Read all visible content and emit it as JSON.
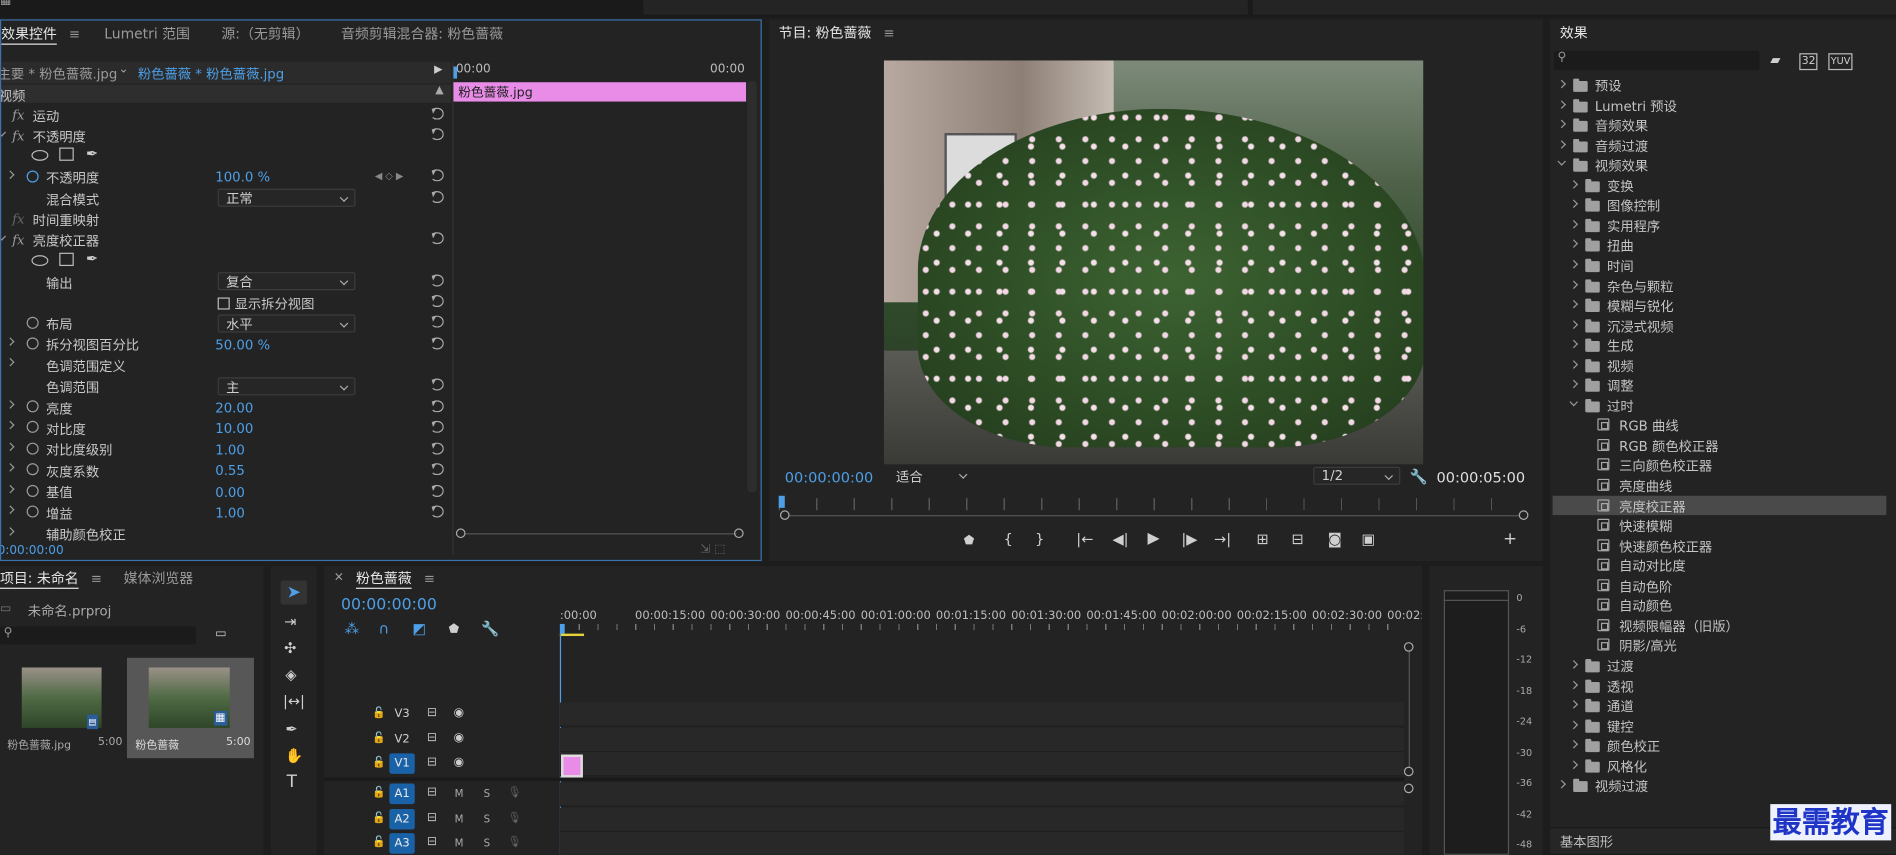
{
  "effect_controls": {
    "tabs": [
      "效果控件",
      "Lumetri 范围",
      "源:（无剪辑）",
      "音频剪辑混合器: 粉色蔷薇"
    ],
    "master_label": "主要 * 粉色蔷薇.jpg",
    "clip_label": "粉色蔷薇 * 粉色蔷薇.jpg",
    "mini_timeline": {
      "start": "00:00",
      "end": "00:00",
      "clip_name": "粉色蔷薇.jpg"
    },
    "section_video": "视频",
    "rows": {
      "motion": "运动",
      "opacity": "不透明度",
      "opacity_param": "不透明度",
      "opacity_value": "100.0 %",
      "blend_mode": "混合模式",
      "blend_value": "正常",
      "time_remap": "时间重映射",
      "luma_corrector": "亮度校正器",
      "output": "输出",
      "output_value": "复合",
      "split_view": "显示拆分视图",
      "layout": "布局",
      "layout_value": "水平",
      "split_pct": "拆分视图百分比",
      "split_pct_value": "50.00 %",
      "tonal_range_def": "色调范围定义",
      "tonal_range": "色调范围",
      "tonal_range_value": "主",
      "brightness": "亮度",
      "brightness_value": "20.00",
      "contrast": "对比度",
      "contrast_value": "10.00",
      "contrast_level": "对比度级别",
      "contrast_level_value": "1.00",
      "gamma": "灰度系数",
      "gamma_value": "0.55",
      "pedestal": "基值",
      "pedestal_value": "0.00",
      "gain": "增益",
      "gain_value": "1.00",
      "secondary": "辅助颜色校正"
    },
    "timecode": "0:00:00:00"
  },
  "program": {
    "title": "节目: 粉色蔷薇",
    "timecode_left": "00:00:00:00",
    "zoom": "适合",
    "resolution": "1/2",
    "timecode_right": "00:00:05:00"
  },
  "effects": {
    "title": "效果",
    "tree": [
      {
        "label": "预设",
        "level": 0,
        "icon": "preset"
      },
      {
        "label": "Lumetri 预设",
        "level": 0,
        "icon": "preset"
      },
      {
        "label": "音频效果",
        "level": 0,
        "icon": "folder"
      },
      {
        "label": "音频过渡",
        "level": 0,
        "icon": "folder"
      },
      {
        "label": "视频效果",
        "level": 0,
        "icon": "folder",
        "open": true
      },
      {
        "label": "变换",
        "level": 1,
        "icon": "folder"
      },
      {
        "label": "图像控制",
        "level": 1,
        "icon": "folder"
      },
      {
        "label": "实用程序",
        "level": 1,
        "icon": "folder"
      },
      {
        "label": "扭曲",
        "level": 1,
        "icon": "folder"
      },
      {
        "label": "时间",
        "level": 1,
        "icon": "folder"
      },
      {
        "label": "杂色与颗粒",
        "level": 1,
        "icon": "folder"
      },
      {
        "label": "模糊与锐化",
        "level": 1,
        "icon": "folder"
      },
      {
        "label": "沉浸式视频",
        "level": 1,
        "icon": "folder"
      },
      {
        "label": "生成",
        "level": 1,
        "icon": "folder"
      },
      {
        "label": "视频",
        "level": 1,
        "icon": "folder"
      },
      {
        "label": "调整",
        "level": 1,
        "icon": "folder"
      },
      {
        "label": "过时",
        "level": 1,
        "icon": "folder",
        "open": true
      },
      {
        "label": "RGB 曲线",
        "level": 2,
        "icon": "effect"
      },
      {
        "label": "RGB 颜色校正器",
        "level": 2,
        "icon": "effect"
      },
      {
        "label": "三向颜色校正器",
        "level": 2,
        "icon": "effect"
      },
      {
        "label": "亮度曲线",
        "level": 2,
        "icon": "effect"
      },
      {
        "label": "亮度校正器",
        "level": 2,
        "icon": "effect",
        "selected": true
      },
      {
        "label": "快速模糊",
        "level": 2,
        "icon": "effect"
      },
      {
        "label": "快速颜色校正器",
        "level": 2,
        "icon": "effect"
      },
      {
        "label": "自动对比度",
        "level": 2,
        "icon": "effect"
      },
      {
        "label": "自动色阶",
        "level": 2,
        "icon": "effect"
      },
      {
        "label": "自动颜色",
        "level": 2,
        "icon": "effect"
      },
      {
        "label": "视频限幅器（旧版）",
        "level": 2,
        "icon": "effect"
      },
      {
        "label": "阴影/高光",
        "level": 2,
        "icon": "effect"
      },
      {
        "label": "过渡",
        "level": 1,
        "icon": "folder"
      },
      {
        "label": "透视",
        "level": 1,
        "icon": "folder"
      },
      {
        "label": "通道",
        "level": 1,
        "icon": "folder"
      },
      {
        "label": "键控",
        "level": 1,
        "icon": "folder"
      },
      {
        "label": "颜色校正",
        "level": 1,
        "icon": "folder"
      },
      {
        "label": "风格化",
        "level": 1,
        "icon": "folder"
      },
      {
        "label": "视频过渡",
        "level": 0,
        "icon": "folder"
      }
    ],
    "essential_graphics": "基本图形"
  },
  "project": {
    "tabs": [
      "项目: 未命名",
      "媒体浏览器"
    ],
    "file": "未命名.prproj",
    "items": [
      {
        "name": "粉色蔷薇.jpg",
        "duration": "5:00"
      },
      {
        "name": "粉色蔷薇",
        "duration": "5:00"
      }
    ]
  },
  "timeline": {
    "title": "粉色蔷薇",
    "timecode": "00:00:00:00",
    "ruler": [
      ":00:00",
      "00:00:15:00",
      "00:00:30:00",
      "00:00:45:00",
      "00:01:00:00",
      "00:01:15:00",
      "00:01:30:00",
      "00:01:45:00",
      "00:02:00:00",
      "00:02:15:00",
      "00:02:30:00",
      "00:02:45:0"
    ],
    "video_tracks": [
      "V3",
      "V2",
      "V1"
    ],
    "audio_tracks": [
      "A1",
      "A2",
      "A3"
    ],
    "track_m": "M",
    "track_s": "S"
  },
  "meter": {
    "scale": [
      "0",
      "-6",
      "-12",
      "-18",
      "-24",
      "-30",
      "-36",
      "-42",
      "-48"
    ]
  },
  "watermark": "最需教育",
  "colors": {
    "accent": "#4d9fe8",
    "clip_pink": "#e88ce8",
    "panel": "#232323",
    "selected_track": "#1a62a8"
  }
}
